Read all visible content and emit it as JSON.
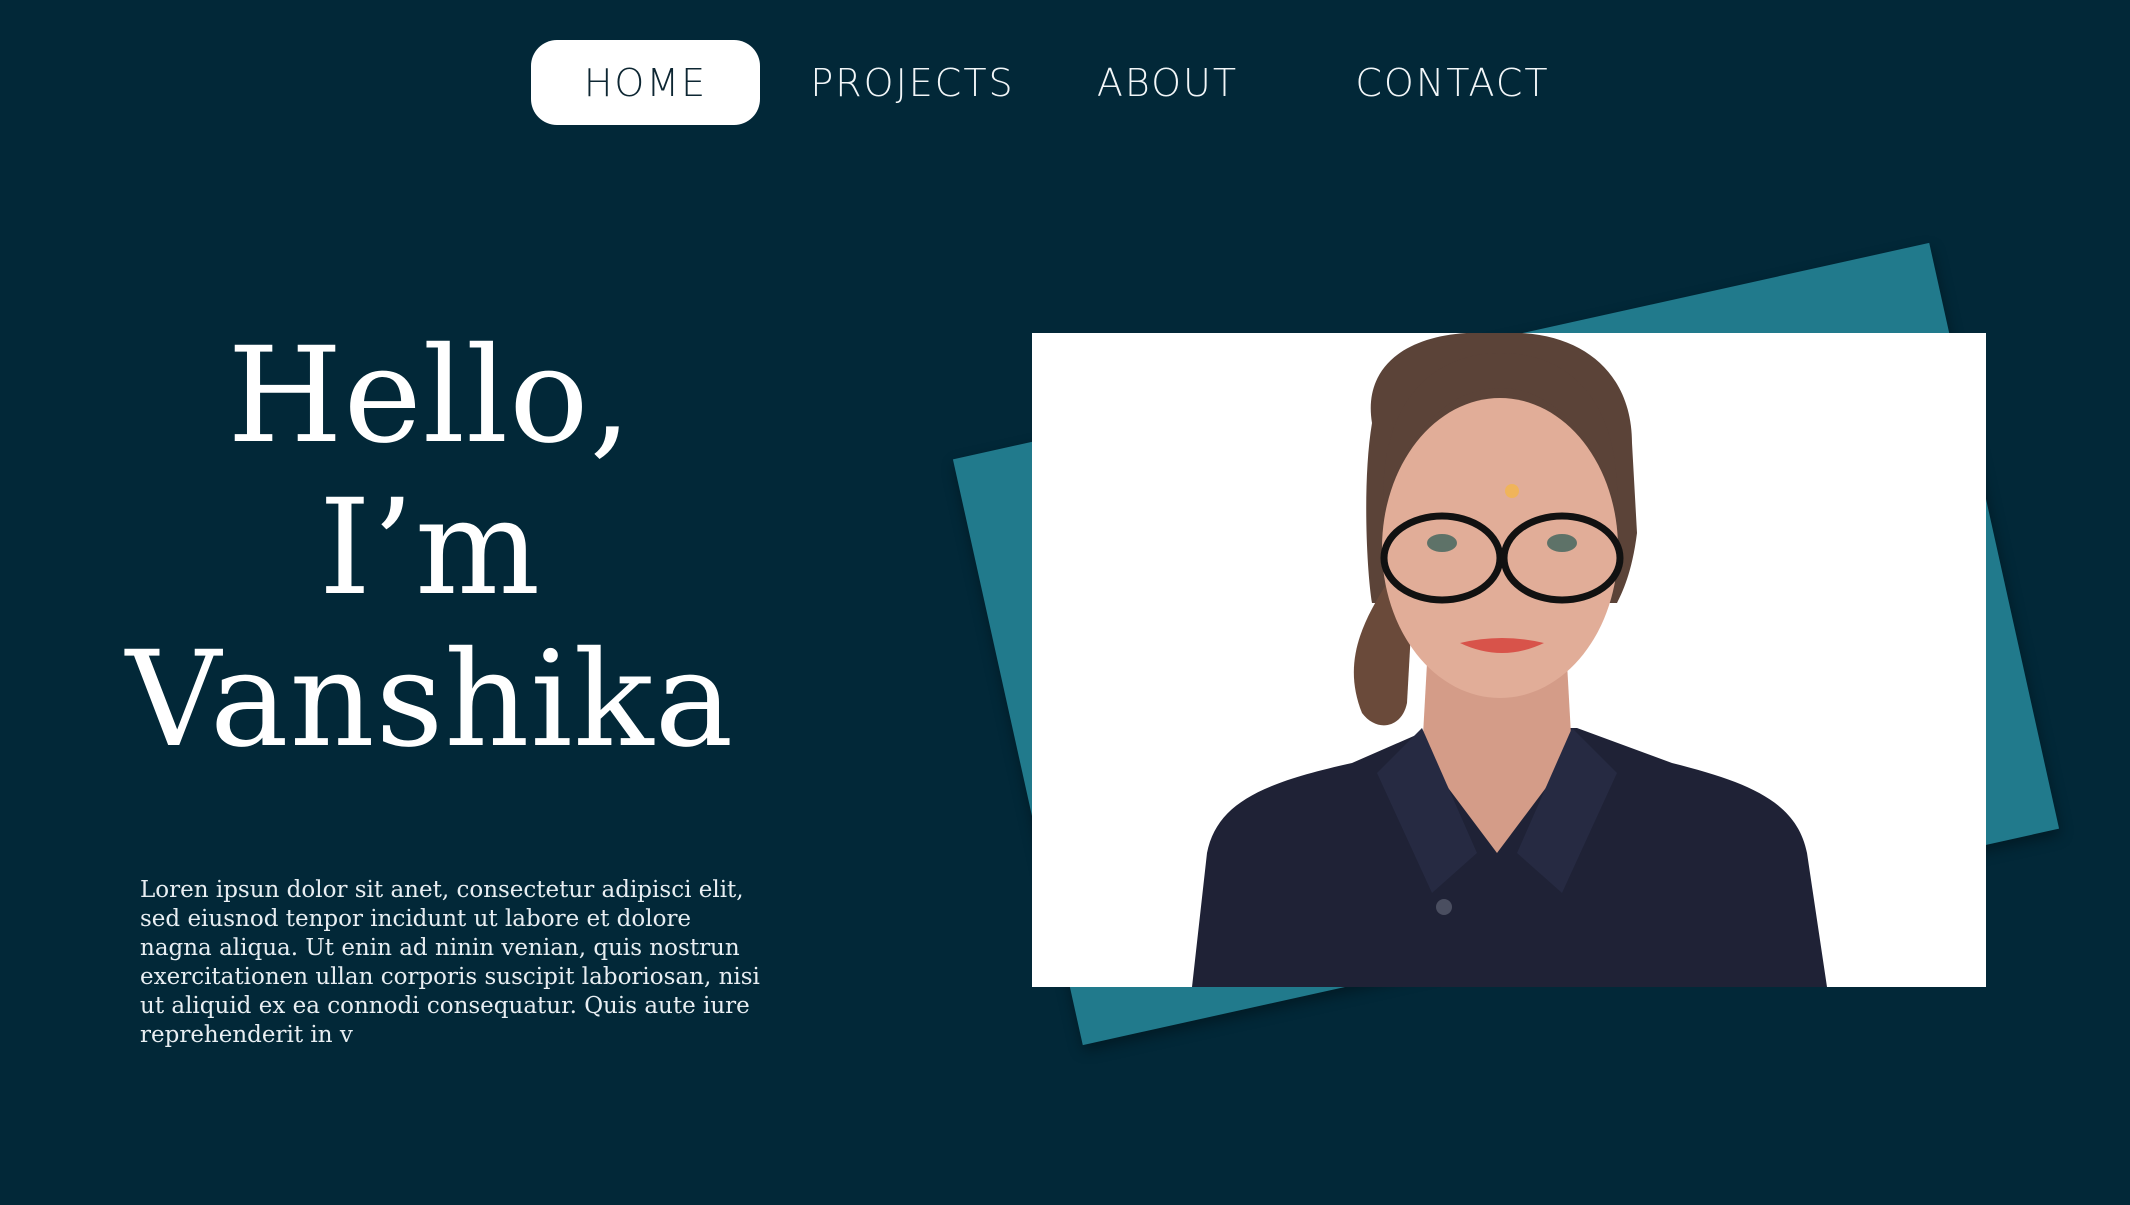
{
  "nav": {
    "items": [
      {
        "label": "Home",
        "active": true
      },
      {
        "label": "Projects",
        "active": false
      },
      {
        "label": "About",
        "active": false
      },
      {
        "label": "Contact",
        "active": false
      }
    ]
  },
  "hero": {
    "line1": "Hello,",
    "line2": "I’m",
    "line3": "Vanshika"
  },
  "intro": {
    "text": "Loren ipsun dolor sit anet, consectetur adipisci elit, sed eiusnod tenpor incidunt ut labore et dolore nagna aliqua. Ut enin ad ninin venian, quis nostrun exercitationen ullan corporis suscipit laboriosan, nisi ut aliquid ex ea connodi consequatur. Quis aute iure reprehenderit in v"
  },
  "colors": {
    "background": "#022838",
    "accent": "#217a8c",
    "nav_active_bg": "#ffffff",
    "text": "#ffffff"
  }
}
